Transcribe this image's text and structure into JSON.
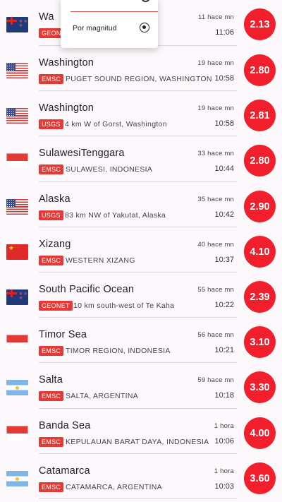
{
  "sort_menu": {
    "option_label": "Por magnitud",
    "selected": true
  },
  "quakes": [
    {
      "flag": "new-zealand-flag",
      "place": "Wa",
      "agency": "GEONET",
      "region": "",
      "ago": "11 hace mn",
      "time": "11:06",
      "magnitude": "2.13"
    },
    {
      "flag": "usa-flag",
      "place": "Washington",
      "agency": "EMSC",
      "region": "PUGET SOUND REGION, WASHINGTON",
      "ago": "19 hace mn",
      "time": "10:58",
      "magnitude": "2.80"
    },
    {
      "flag": "usa-flag",
      "place": "Washington",
      "agency": "USGS",
      "region": "4 km W of Gorst, Washington",
      "ago": "19 hace mn",
      "time": "10:58",
      "magnitude": "2.81"
    },
    {
      "flag": "indonesia-flag",
      "place": "SulawesiTenggara",
      "agency": "EMSC",
      "region": "SULAWESI, INDONESIA",
      "ago": "33 hace mn",
      "time": "10:44",
      "magnitude": "2.80"
    },
    {
      "flag": "usa-flag",
      "place": "Alaska",
      "agency": "USGS",
      "region": "83 km NW of Yakutat, Alaska",
      "ago": "35 hace mn",
      "time": "10:42",
      "magnitude": "2.90"
    },
    {
      "flag": "china-flag",
      "place": "Xizang",
      "agency": "EMSC",
      "region": "WESTERN XIZANG",
      "ago": "40 hace mn",
      "time": "10:37",
      "magnitude": "4.10"
    },
    {
      "flag": "new-zealand-flag",
      "place": "South Pacific Ocean",
      "agency": "GEONET",
      "region": "10 km south-west of Te Kaha",
      "ago": "55 hace mn",
      "time": "10:22",
      "magnitude": "2.39"
    },
    {
      "flag": "indonesia-flag",
      "place": "Timor Sea",
      "agency": "EMSC",
      "region": "TIMOR REGION, INDONESIA",
      "ago": "56 hace mn",
      "time": "10:21",
      "magnitude": "3.10"
    },
    {
      "flag": "argentina-flag",
      "place": "Salta",
      "agency": "EMSC",
      "region": "SALTA, ARGENTINA",
      "ago": "59 hace mn",
      "time": "10:18",
      "magnitude": "3.30"
    },
    {
      "flag": "indonesia-flag",
      "place": "Banda Sea",
      "agency": "EMSC",
      "region": "KEPULAUAN BARAT DAYA, INDONESIA",
      "ago": "1 hora",
      "time": "10:06",
      "magnitude": "4.00"
    },
    {
      "flag": "argentina-flag",
      "place": "Catamarca",
      "agency": "EMSC",
      "region": "CATAMARCA, ARGENTINA",
      "ago": "1 hora",
      "time": "10:03",
      "magnitude": "3.60"
    }
  ]
}
